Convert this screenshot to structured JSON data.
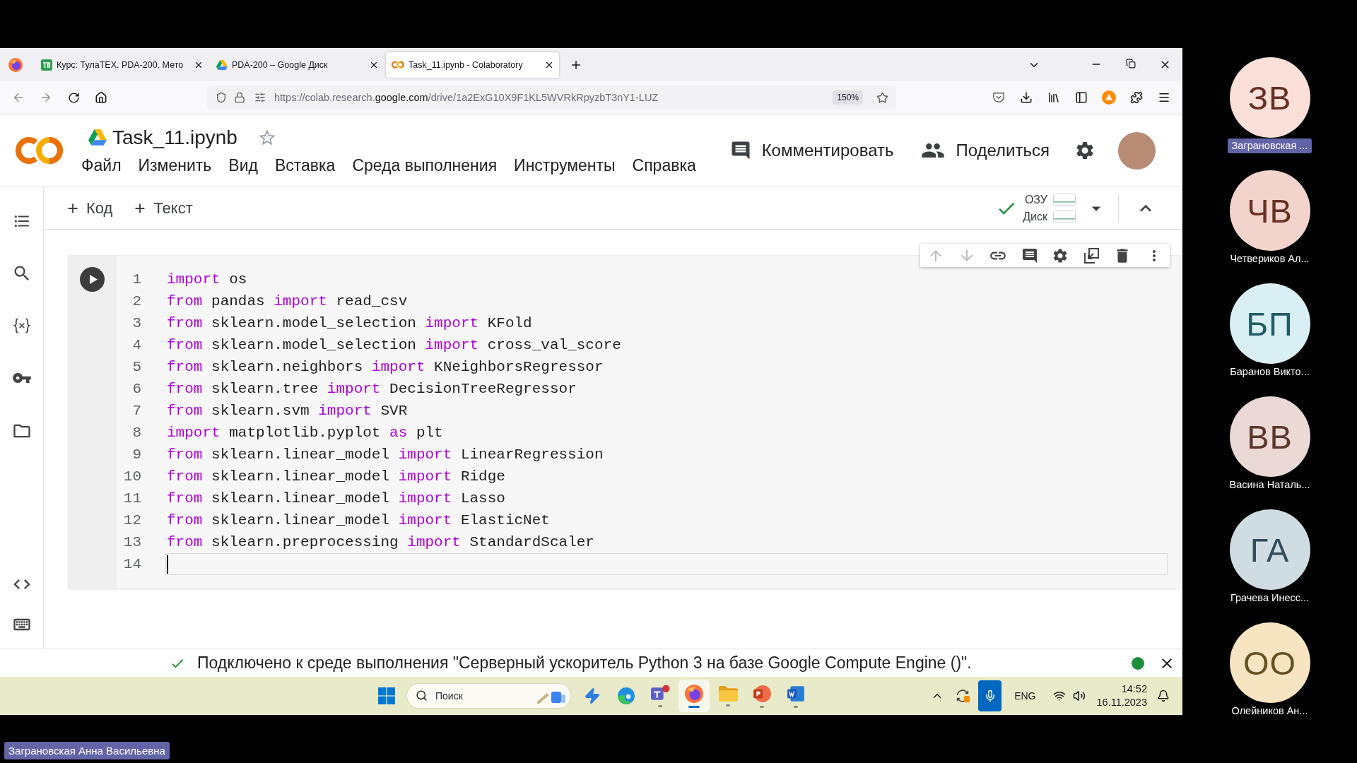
{
  "browser": {
    "tabs": [
      {
        "title": "Курс: ТулаТЕХ. PDA-200. Мето",
        "selected": false
      },
      {
        "title": "PDA-200 – Google Диск",
        "selected": false
      },
      {
        "title": "Task_11.ipynb - Colaboratory",
        "selected": true
      }
    ],
    "url": "https://colab.research.**google.com**/drive/1a2ExG10X9F1KL5WVRkRpyzbT3nY1-LUZ",
    "zoom": "150%"
  },
  "notebook": {
    "title": "Task_11.ipynb",
    "starred": false,
    "menu": [
      "Файл",
      "Изменить",
      "Вид",
      "Вставка",
      "Среда выполнения",
      "Инструменты",
      "Справка"
    ],
    "comment": "Комментировать",
    "share": "Поделиться",
    "add_buttons": [
      "Код",
      "Текст"
    ],
    "resources": [
      "ОЗУ",
      "Диск"
    ],
    "cell_tools": [
      {
        "kind": "up",
        "disabled": true
      },
      {
        "kind": "down",
        "disabled": true
      },
      {
        "kind": "link",
        "disabled": false
      },
      {
        "kind": "comment",
        "disabled": false
      },
      {
        "kind": "settings",
        "disabled": false
      },
      {
        "kind": "mirror",
        "disabled": false
      },
      {
        "kind": "delete",
        "disabled": false
      },
      {
        "kind": "more",
        "disabled": false
      }
    ],
    "lines": [
      {
        "number": "1",
        "current": false,
        "tokens": [
          {
            "kind": "keyword",
            "text": "import"
          },
          {
            "kind": "plain",
            "text": " os"
          }
        ]
      },
      {
        "number": "2",
        "current": false,
        "tokens": [
          {
            "kind": "keyword",
            "text": "from"
          },
          {
            "kind": "plain",
            "text": " pandas "
          },
          {
            "kind": "keyword",
            "text": "import"
          },
          {
            "kind": "plain",
            "text": " read_csv"
          }
        ]
      },
      {
        "number": "3",
        "current": false,
        "tokens": [
          {
            "kind": "keyword",
            "text": "from"
          },
          {
            "kind": "plain",
            "text": " sklearn.model_selection "
          },
          {
            "kind": "keyword",
            "text": "import"
          },
          {
            "kind": "plain",
            "text": " KFold"
          }
        ]
      },
      {
        "number": "4",
        "current": false,
        "tokens": [
          {
            "kind": "keyword",
            "text": "from"
          },
          {
            "kind": "plain",
            "text": " sklearn.model_selection "
          },
          {
            "kind": "keyword",
            "text": "import"
          },
          {
            "kind": "plain",
            "text": " cross_val_score"
          }
        ]
      },
      {
        "number": "5",
        "current": false,
        "tokens": [
          {
            "kind": "keyword",
            "text": "from"
          },
          {
            "kind": "plain",
            "text": " sklearn.neighbors "
          },
          {
            "kind": "keyword",
            "text": "import"
          },
          {
            "kind": "plain",
            "text": " KNeighborsRegressor"
          }
        ]
      },
      {
        "number": "6",
        "current": false,
        "tokens": [
          {
            "kind": "keyword",
            "text": "from"
          },
          {
            "kind": "plain",
            "text": " sklearn.tree "
          },
          {
            "kind": "keyword",
            "text": "import"
          },
          {
            "kind": "plain",
            "text": " DecisionTreeRegressor"
          }
        ]
      },
      {
        "number": "7",
        "current": false,
        "tokens": [
          {
            "kind": "keyword",
            "text": "from"
          },
          {
            "kind": "plain",
            "text": " sklearn.svm "
          },
          {
            "kind": "keyword",
            "text": "import"
          },
          {
            "kind": "plain",
            "text": " SVR"
          }
        ]
      },
      {
        "number": "8",
        "current": false,
        "tokens": [
          {
            "kind": "keyword",
            "text": "import"
          },
          {
            "kind": "plain",
            "text": " matplotlib.pyplot "
          },
          {
            "kind": "keyword",
            "text": "as"
          },
          {
            "kind": "plain",
            "text": " plt"
          }
        ]
      },
      {
        "number": "9",
        "current": false,
        "tokens": [
          {
            "kind": "keyword",
            "text": "from"
          },
          {
            "kind": "plain",
            "text": " sklearn.linear_model "
          },
          {
            "kind": "keyword",
            "text": "import"
          },
          {
            "kind": "plain",
            "text": " LinearRegression"
          }
        ]
      },
      {
        "number": "10",
        "current": false,
        "tokens": [
          {
            "kind": "keyword",
            "text": "from"
          },
          {
            "kind": "plain",
            "text": " sklearn.linear_model "
          },
          {
            "kind": "keyword",
            "text": "import"
          },
          {
            "kind": "plain",
            "text": " Ridge"
          }
        ]
      },
      {
        "number": "11",
        "current": false,
        "tokens": [
          {
            "kind": "keyword",
            "text": "from"
          },
          {
            "kind": "plain",
            "text": " sklearn.linear_model "
          },
          {
            "kind": "keyword",
            "text": "import"
          },
          {
            "kind": "plain",
            "text": " Lasso"
          }
        ]
      },
      {
        "number": "12",
        "current": false,
        "tokens": [
          {
            "kind": "keyword",
            "text": "from"
          },
          {
            "kind": "plain",
            "text": " sklearn.linear_model "
          },
          {
            "kind": "keyword",
            "text": "import"
          },
          {
            "kind": "plain",
            "text": " ElasticNet"
          }
        ]
      },
      {
        "number": "13",
        "current": false,
        "tokens": [
          {
            "kind": "keyword",
            "text": "from"
          },
          {
            "kind": "plain",
            "text": " sklearn.preprocessing "
          },
          {
            "kind": "keyword",
            "text": "import"
          },
          {
            "kind": "plain",
            "text": " StandardScaler"
          }
        ]
      },
      {
        "number": "14",
        "current": true
      }
    ],
    "status": "Подключено к среде выполнения \"Серверный ускоритель Python 3 на базе Google Compute Engine ()\"."
  },
  "taskbar": {
    "search": {
      "placeholder": "Поиск"
    },
    "apps": [
      {
        "kind": "bolt",
        "running": false,
        "active": false
      },
      {
        "kind": "edge",
        "running": false,
        "active": false
      },
      {
        "kind": "teams",
        "running": true,
        "active": false
      },
      {
        "kind": "firefox",
        "running": true,
        "active": true
      },
      {
        "kind": "files",
        "running": true,
        "active": false
      },
      {
        "kind": "powerpoint",
        "running": true,
        "active": false
      },
      {
        "kind": "word",
        "running": true,
        "active": false
      }
    ],
    "language": "ENG",
    "time": "14:52",
    "date": "16.11.2023"
  },
  "participants": [
    {
      "initials": "ЗВ",
      "name": "Заграновская ...",
      "color": "#fbe0da",
      "highlighted": true
    },
    {
      "initials": "ЧВ",
      "name": "Четвериков Ал...",
      "color": "#f3d4cc",
      "highlighted": false
    },
    {
      "initials": "БП",
      "name": "Баранов Викто...",
      "color": "#d9eff3",
      "highlighted": false
    },
    {
      "initials": "ВВ",
      "name": "Васина Наталь...",
      "color": "#ead9d5",
      "highlighted": false
    },
    {
      "initials": "ГА",
      "name": "Грачева Инесс...",
      "color": "#cfdde3",
      "highlighted": false
    },
    {
      "initials": "ОО",
      "name": "Олейников Ан...",
      "color": "#f7e4c0",
      "highlighted": false
    }
  ],
  "presenter": "Заграновская Анна Васильевна"
}
